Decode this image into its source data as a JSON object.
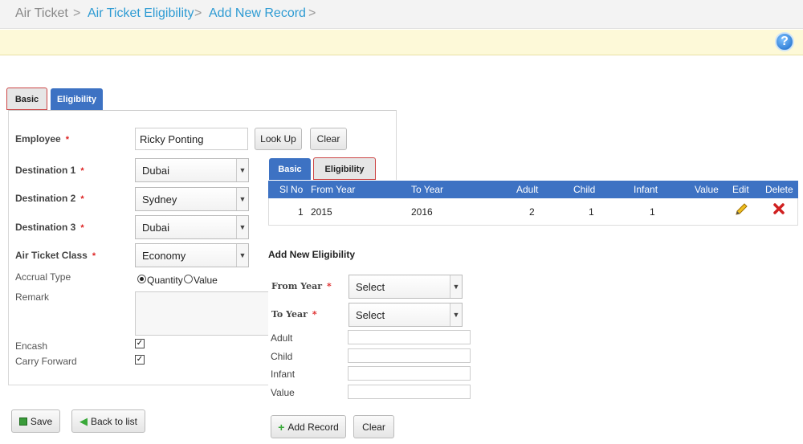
{
  "breadcrumb": {
    "item1": "Air Ticket",
    "item2": "Air Ticket Eligibility",
    "item3": "Add New Record",
    "sep": ">"
  },
  "help": {
    "label": "?"
  },
  "tabs": {
    "basic": "Basic",
    "eligibility": "Eligibility"
  },
  "form": {
    "employee_label": "Employee",
    "employee_value": "Ricky Ponting",
    "lookup_label": "Look Up",
    "clear_label": "Clear",
    "dest1_label": "Destination 1",
    "dest1_value": "Dubai",
    "dest2_label": "Destination 2",
    "dest2_value": "Sydney",
    "dest3_label": "Destination 3",
    "dest3_value": "Dubai",
    "class_label": "Air Ticket Class",
    "class_value": "Economy",
    "accrual_label": "Accrual Type",
    "accrual_opt1": "Quantity",
    "accrual_opt2": "Value",
    "remark_label": "Remark",
    "encash_label": "Encash",
    "carry_label": "Carry Forward",
    "required_mark": "*"
  },
  "actions": {
    "save": "Save",
    "back": "Back to list"
  },
  "grid": {
    "headers": [
      "Sl No",
      "From Year",
      "To Year",
      "Adult",
      "Child",
      "Infant",
      "Value",
      "Edit",
      "Delete"
    ],
    "rows": [
      {
        "sl": "1",
        "from": "2015",
        "to": "2016",
        "adult": "2",
        "child": "1",
        "infant": "1",
        "value": ""
      }
    ]
  },
  "new_eligibility": {
    "title": "Add New Eligibility",
    "from_label": "From Year",
    "from_value": "Select",
    "to_label": "To Year",
    "to_value": "Select",
    "adult_label": "Adult",
    "child_label": "Child",
    "infant_label": "Infant",
    "value_label": "Value",
    "add_label": "Add Record",
    "clear_label": "Clear"
  },
  "colors": {
    "accent": "#3d72c3",
    "link": "#2e9bd3",
    "notice": "#fdf9d8"
  }
}
